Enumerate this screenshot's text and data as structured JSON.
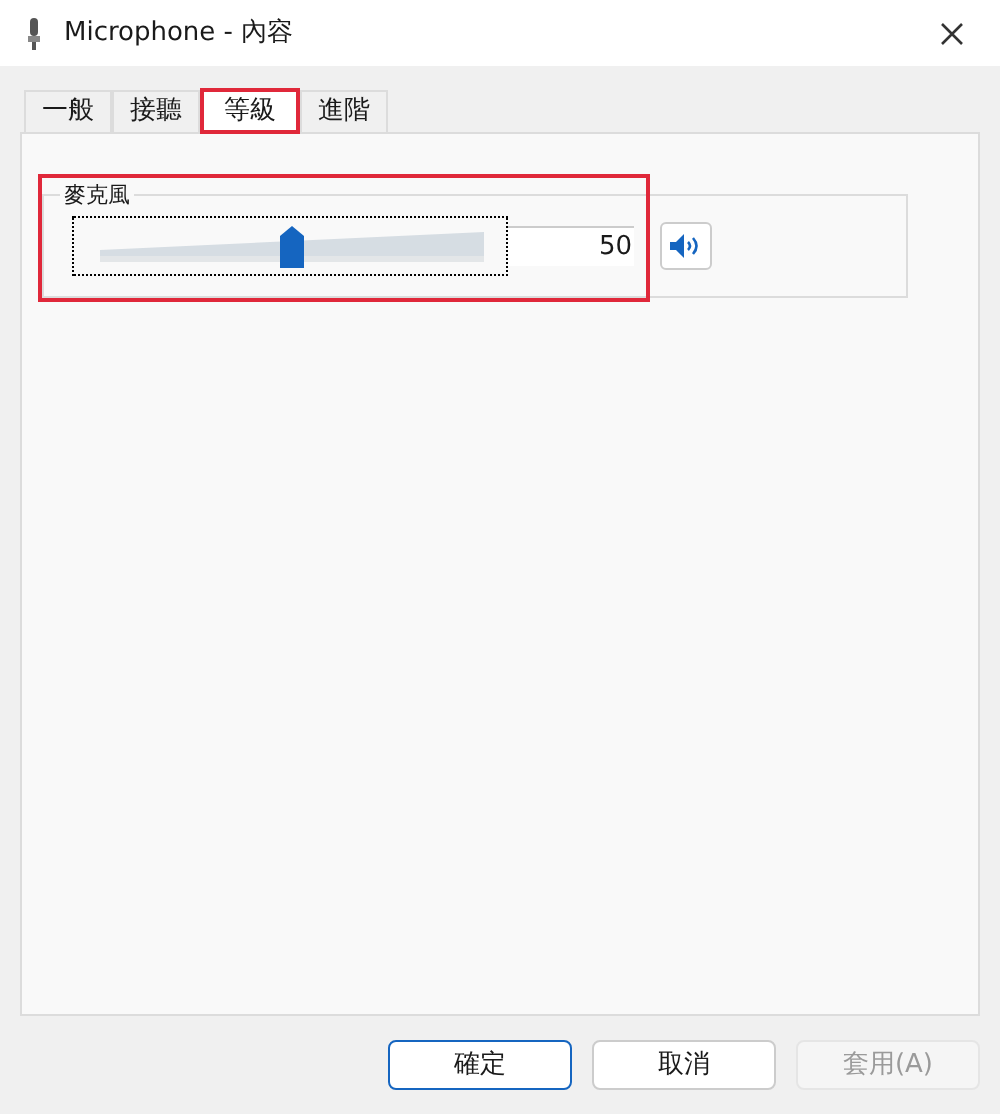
{
  "window": {
    "title": "Microphone - 內容"
  },
  "tabs": [
    {
      "label": "一般",
      "selected": false
    },
    {
      "label": "接聽",
      "selected": false
    },
    {
      "label": "等級",
      "selected": true
    },
    {
      "label": "進階",
      "selected": false
    }
  ],
  "group": {
    "title": "麥克風",
    "slider": {
      "level": 0.5,
      "reading": "50"
    },
    "muted": false
  },
  "buttons": [
    {
      "label": "確定",
      "default": true,
      "disabled": false
    },
    {
      "label": "取消",
      "default": false,
      "disabled": false
    },
    {
      "label": "套用(A)",
      "default": false,
      "disabled": true
    }
  ]
}
